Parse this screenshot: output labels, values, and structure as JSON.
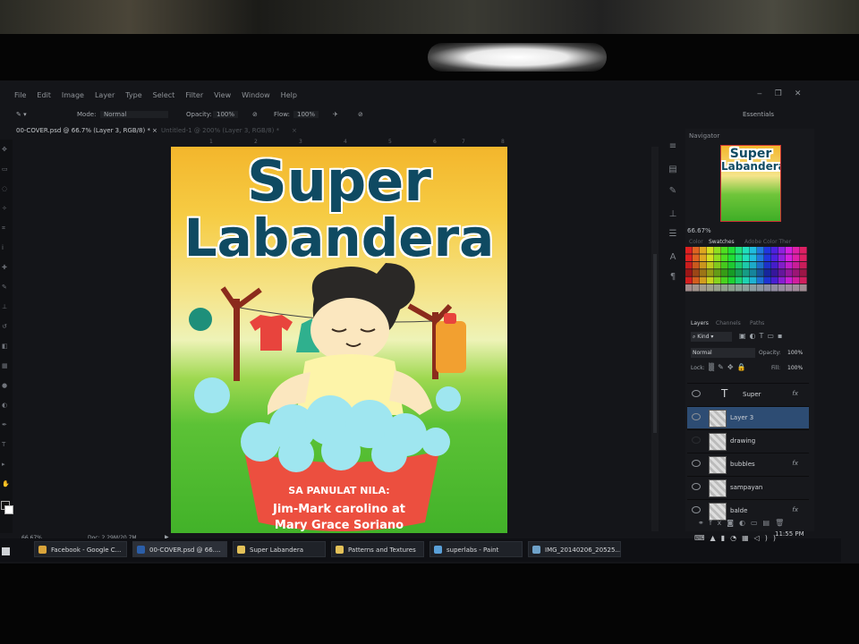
{
  "menu": [
    "File",
    "Edit",
    "Image",
    "Layer",
    "Type",
    "Select",
    "Filter",
    "View",
    "Window",
    "Help"
  ],
  "window_controls": [
    "‒",
    "❐",
    "✕"
  ],
  "options": {
    "mode_label": "Mode:",
    "mode_value": "Normal",
    "opacity_label": "Opacity:",
    "opacity_value": "100%",
    "flow_label": "Flow:",
    "flow_value": "100%",
    "workspace": "Essentials"
  },
  "tabs": {
    "active": "00-COVER.psd @ 66.7% (Layer 3, RGB/8) *",
    "inactive": "Untitled-1 @ 200% (Layer 3, RGB/8) *"
  },
  "ruler_ticks": [
    "1",
    "2",
    "3",
    "4",
    "5",
    "6",
    "7",
    "8"
  ],
  "cover": {
    "title_line1": "Super",
    "title_line2": "Labandera",
    "byline": "SA PANULAT NILA:",
    "authors_line1": "Jim-Mark carolino at",
    "authors_line2": "Mary Grace Soriano",
    "colors": {
      "title": "#0f4a62",
      "shirt": "#e8443d",
      "jug": "#f2a030",
      "basin": "#ec4f3f",
      "bubble": "#9fe6f0",
      "pole": "#8b2b1c",
      "ball": "#1e8f7a"
    }
  },
  "navigator": {
    "title": "Navigator",
    "zoom": "66.67%"
  },
  "swatch_tabs": [
    "Color",
    "Swatches",
    "Adobe Color Themes"
  ],
  "layers_panel": {
    "tabs": [
      "Layers",
      "Channels",
      "Paths"
    ],
    "filter": "Kind",
    "blend_mode": "Normal",
    "opacity_label": "Opacity:",
    "opacity_value": "100%",
    "lock_label": "Lock:",
    "fill_label": "Fill:",
    "fill_value": "100%",
    "layers": [
      {
        "name": "Super",
        "type": "text",
        "fx": "fx",
        "visible": true
      },
      {
        "name": "Layer 3",
        "type": "pixel",
        "fx": "",
        "visible": true,
        "selected": true
      },
      {
        "name": "drawing",
        "type": "pixel",
        "fx": "",
        "visible": false
      },
      {
        "name": "bubbles",
        "type": "pixel",
        "fx": "fx",
        "visible": true
      },
      {
        "name": "sampayan",
        "type": "pixel",
        "fx": "",
        "visible": true
      },
      {
        "name": "balde",
        "type": "pixel",
        "fx": "fx",
        "visible": true
      }
    ]
  },
  "status": {
    "zoom": "66.67%",
    "doc": "Doc: 2.29M/20.7M"
  },
  "taskbar": [
    {
      "label": "Facebook - Google C...",
      "icon": "chrome-icon",
      "color": "#d9a43a"
    },
    {
      "label": "00-COVER.psd @ 66....",
      "icon": "photoshop-icon",
      "color": "#2b5ea8"
    },
    {
      "label": "Super Labandera",
      "icon": "folder-icon",
      "color": "#e3c158"
    },
    {
      "label": "Patterns and Textures",
      "icon": "folder-icon",
      "color": "#e3c158"
    },
    {
      "label": "superlabs - Paint",
      "icon": "paint-icon",
      "color": "#5aa0d8"
    },
    {
      "label": "IMG_20140206_20525...",
      "icon": "image-viewer-icon",
      "color": "#6fa2c9"
    }
  ],
  "clock": "11:55 PM"
}
